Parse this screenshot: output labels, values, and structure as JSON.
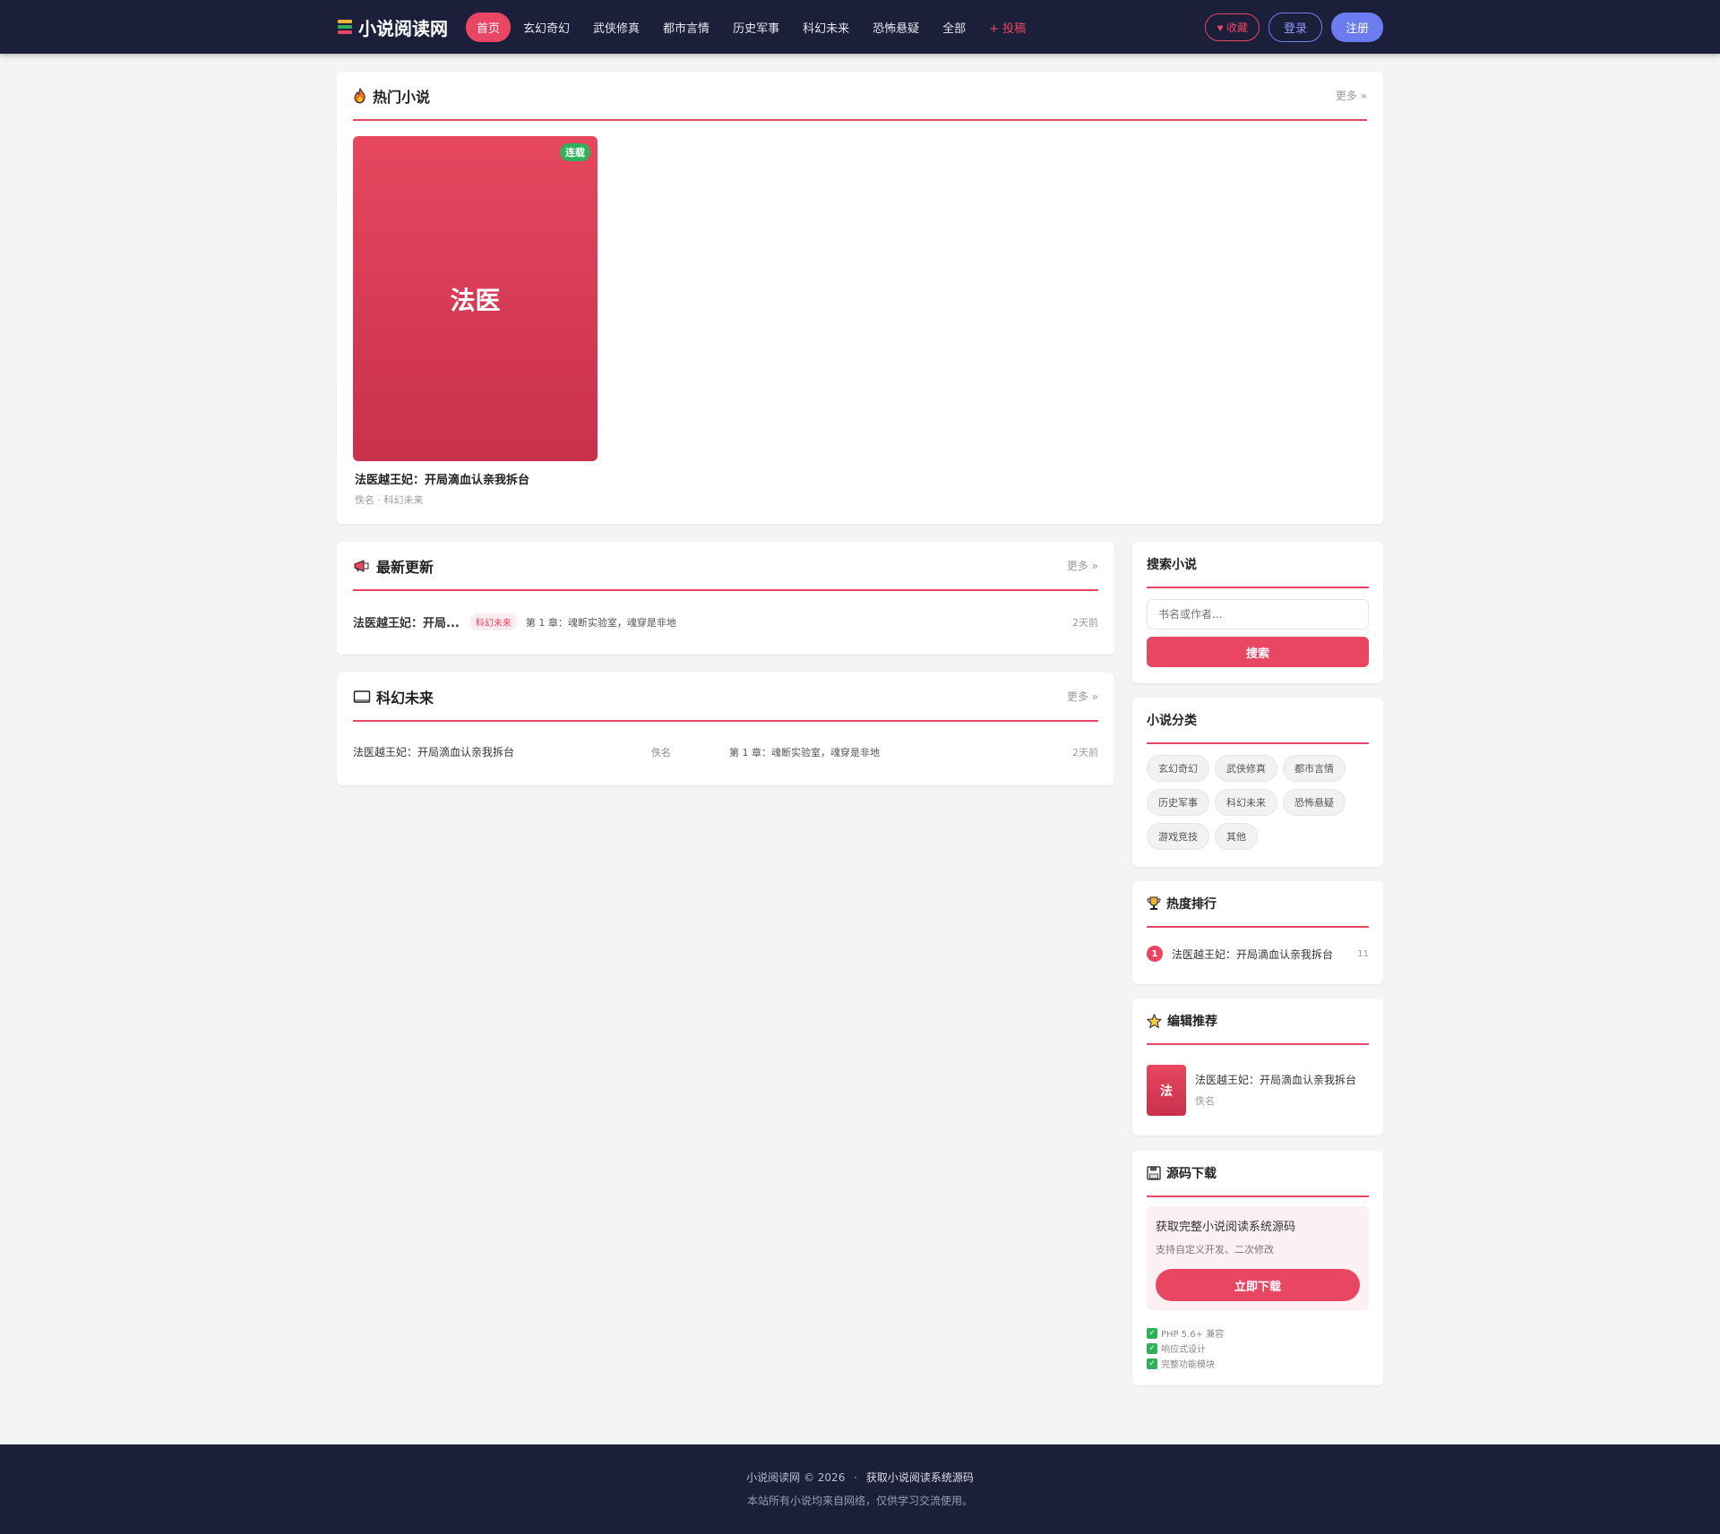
{
  "site": {
    "name": "小说阅读网",
    "logo_icon": "books-icon"
  },
  "nav": {
    "items": [
      {
        "label": "首页",
        "active": true
      },
      {
        "label": "玄幻奇幻"
      },
      {
        "label": "武侠修真"
      },
      {
        "label": "都市言情"
      },
      {
        "label": "历史军事"
      },
      {
        "label": "科幻未来"
      },
      {
        "label": "恐怖悬疑"
      },
      {
        "label": "全部"
      }
    ],
    "submit_label": "+ 投稿"
  },
  "header_actions": {
    "favorite_label": "收藏",
    "login_label": "登录",
    "register_label": "注册"
  },
  "hot": {
    "title": "热门小说",
    "more": "更多 »",
    "book": {
      "cover_text": "法医",
      "badge": "连载",
      "title": "法医越王妃：开局滴血认亲我拆台",
      "meta": "佚名 · 科幻未来"
    }
  },
  "latest": {
    "title": "最新更新",
    "more": "更多 »",
    "rows": [
      {
        "title": "法医越王妃：开局...",
        "tag": "科幻未来",
        "chapter": "第 1 章：魂断实验室，魂穿是非地",
        "time": "2天前"
      }
    ]
  },
  "scifi": {
    "title": "科幻未来",
    "more": "更多 »",
    "rows": [
      {
        "title": "法医越王妃：开局滴血认亲我拆台",
        "author": "佚名",
        "chapter": "第 1 章：魂断实验室，魂穿是非地",
        "time": "2天前"
      }
    ]
  },
  "search": {
    "title": "搜索小说",
    "placeholder": "书名或作者...",
    "button": "搜索"
  },
  "categories": {
    "title": "小说分类",
    "items": [
      "玄幻奇幻",
      "武侠修真",
      "都市言情",
      "历史军事",
      "科幻未来",
      "恐怖悬疑",
      "游戏竞技",
      "其他"
    ]
  },
  "ranking": {
    "title": "热度排行",
    "items": [
      {
        "rank": "1",
        "title": "法医越王妃：开局滴血认亲我拆台",
        "count": "11"
      }
    ]
  },
  "editor": {
    "title": "编辑推荐",
    "items": [
      {
        "cover_text": "法",
        "title": "法医越王妃：开局滴血认亲我拆台",
        "author": "佚名"
      }
    ]
  },
  "download": {
    "title": "源码下载",
    "box_title": "获取完整小说阅读系统源码",
    "box_sub": "支持自定义开发、二次修改",
    "button": "立即下载",
    "features": [
      "PHP 5.6+ 兼容",
      "响应式设计",
      "完整功能模块"
    ]
  },
  "footer": {
    "copyright": "小说阅读网 © 2026",
    "separator": "·",
    "link": "获取小说阅读系统源码",
    "note": "本站所有小说均来自网络，仅供学习交流使用。"
  },
  "colors": {
    "accent": "#e84663",
    "header_bg": "#1b1f3a",
    "page_bg": "#f4f4f5",
    "badge_green": "#2fb05a",
    "register_blue": "#6b7cf0"
  }
}
